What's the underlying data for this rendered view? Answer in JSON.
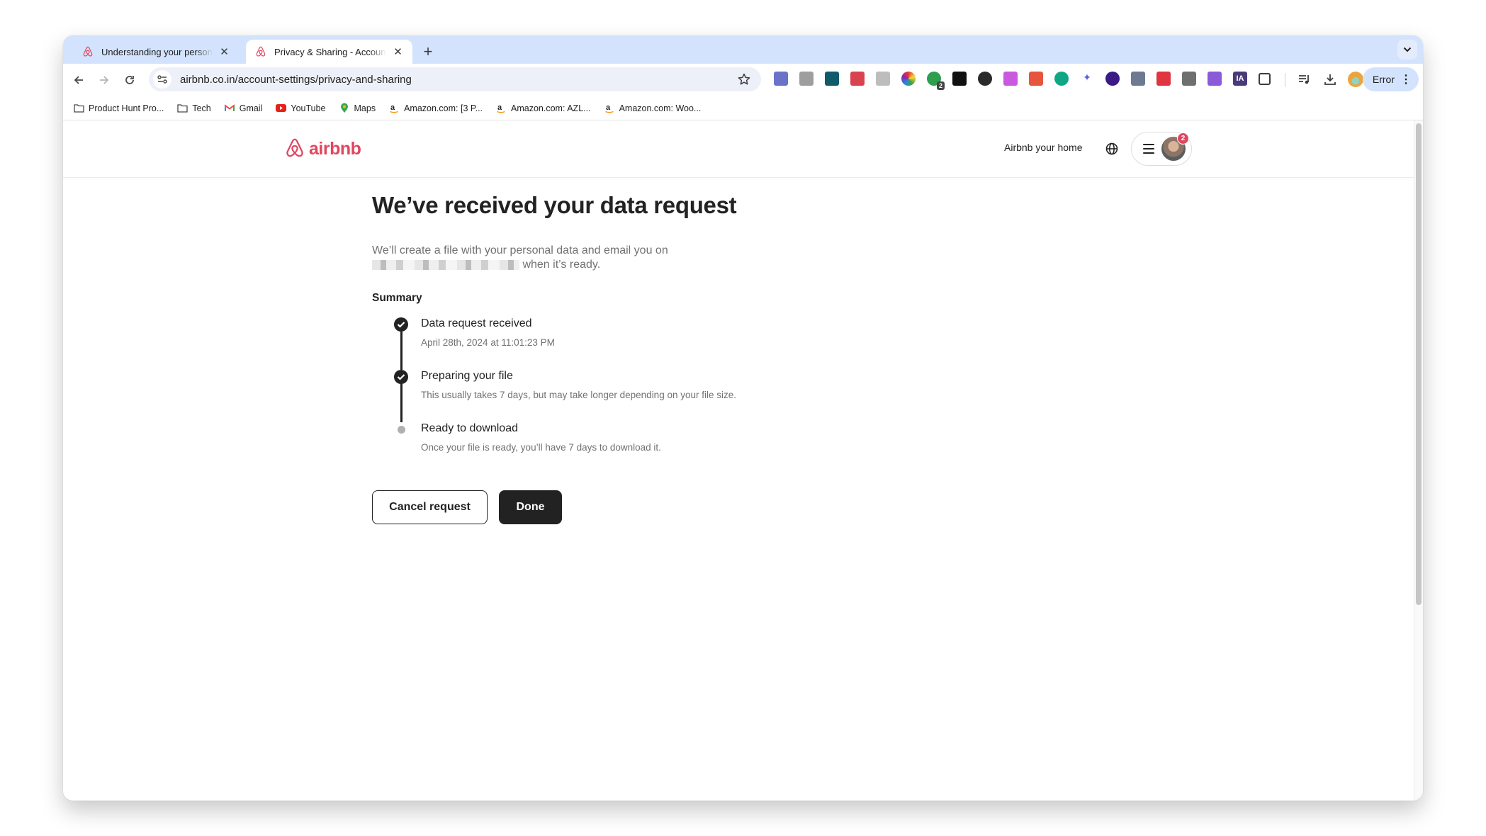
{
  "browser": {
    "tabs": [
      {
        "title": "Understanding your personal data",
        "active": false,
        "icon": "airbnb-icon"
      },
      {
        "title": "Privacy & Sharing - Account Settings",
        "active": true,
        "icon": "airbnb-icon"
      }
    ],
    "new_tab_label": "+",
    "url": "airbnb.co.in/account-settings/privacy-and-sharing",
    "extensions": [
      {
        "name": "ext-stack-icon",
        "color": "#6b73c9"
      },
      {
        "name": "ext-user-icon",
        "color": "#9e9e9e"
      },
      {
        "name": "ext-bracket-icon",
        "color": "#0f5b6b"
      },
      {
        "name": "ext-bars-icon",
        "color": "#d9434f"
      },
      {
        "name": "ext-hk-icon",
        "color": "#bdbdbd"
      },
      {
        "name": "ext-colorwheel-icon",
        "color": "#7b3fe4"
      },
      {
        "name": "ext-shield-icon",
        "color": "#2e9e4f",
        "badge": "2"
      },
      {
        "name": "ext-gear-black-icon",
        "color": "#111111"
      },
      {
        "name": "ext-ring-icon",
        "color": "#2a2a2a"
      },
      {
        "name": "ext-chat-icon",
        "color": "#c95ae0"
      },
      {
        "name": "ext-record-icon",
        "color": "#e6553e"
      },
      {
        "name": "ext-grammarly-icon",
        "color": "#11a683"
      },
      {
        "name": "ext-sparkle-icon",
        "color": "#5a5ee0"
      },
      {
        "name": "ext-download-circle-icon",
        "color": "#3a1a86"
      },
      {
        "name": "ext-screen-icon",
        "color": "#6d7a91"
      },
      {
        "name": "ext-image-icon",
        "color": "#e0343e"
      },
      {
        "name": "ext-inbox-icon",
        "color": "#6f6f6f"
      },
      {
        "name": "ext-feather-icon",
        "color": "#8a5ad8"
      },
      {
        "name": "ext-ia-icon",
        "color": "#4a3a7a",
        "text": "IA"
      },
      {
        "name": "ext-puzzle-icon",
        "color": "#3c3c3c"
      }
    ],
    "error_label": "Error",
    "bookmarks": [
      {
        "label": "Product Hunt Pro...",
        "icon": "folder-icon"
      },
      {
        "label": "Tech",
        "icon": "folder-icon"
      },
      {
        "label": "Gmail",
        "icon": "gmail-icon"
      },
      {
        "label": "YouTube",
        "icon": "youtube-icon"
      },
      {
        "label": "Maps",
        "icon": "maps-icon"
      },
      {
        "label": "Amazon.com: [3 P...",
        "icon": "amazon-icon"
      },
      {
        "label": "Amazon.com: AZL...",
        "icon": "amazon-icon"
      },
      {
        "label": "Amazon.com: Woo...",
        "icon": "amazon-icon"
      }
    ]
  },
  "site": {
    "brand": "airbnb",
    "brand_color": "#e0475f",
    "host_link": "Airbnb your home",
    "notification_count": "2"
  },
  "main": {
    "title": "We’ve received your data request",
    "intro_line1": "We’ll create a file with your personal data and email you on",
    "intro_line2": "when it’s ready.",
    "summary_label": "Summary",
    "steps": [
      {
        "title": "Data request received",
        "subtitle": "April 28th, 2024 at 11:01:23 PM",
        "status": "complete"
      },
      {
        "title": "Preparing your file",
        "subtitle": "This usually takes 7 days, but may take longer depending on your file size.",
        "status": "complete"
      },
      {
        "title": "Ready to download",
        "subtitle": "Once your file is ready, you’ll have 7 days to download it.",
        "status": "pending"
      }
    ],
    "cancel_label": "Cancel request",
    "done_label": "Done"
  }
}
